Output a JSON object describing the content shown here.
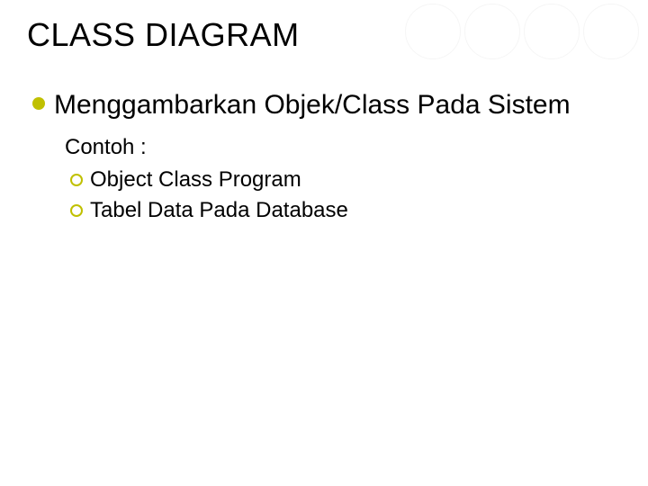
{
  "slide": {
    "title": "CLASS DIAGRAM",
    "bullet1": "Menggambarkan Objek/Class Pada Sistem",
    "contoh_label": "Contoh :",
    "sub1": "Object Class Program",
    "sub2": "Tabel Data Pada Database"
  }
}
